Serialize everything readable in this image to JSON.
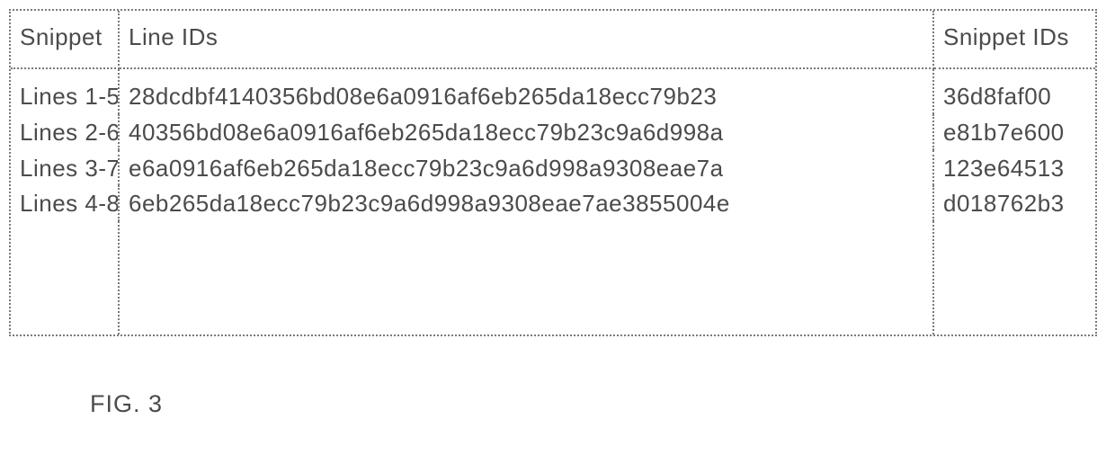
{
  "table": {
    "headers": {
      "snippet": "Snippet",
      "line_ids": "Line IDs",
      "snippet_ids": "Snippet IDs"
    },
    "rows": [
      {
        "snippet": "Lines 1-5",
        "line_ids": "28dcdbf4140356bd08e6a0916af6eb265da18ecc79b23",
        "snippet_ids": "36d8faf00"
      },
      {
        "snippet": "Lines 2-6",
        "line_ids": "40356bd08e6a0916af6eb265da18ecc79b23c9a6d998a",
        "snippet_ids": "e81b7e600"
      },
      {
        "snippet": "Lines 3-7",
        "line_ids": "e6a0916af6eb265da18ecc79b23c9a6d998a9308eae7a",
        "snippet_ids": "123e64513"
      },
      {
        "snippet": "Lines 4-8",
        "line_ids": "6eb265da18ecc79b23c9a6d998a9308eae7ae3855004e",
        "snippet_ids": "d018762b3"
      }
    ]
  },
  "figure_label": "FIG. 3"
}
